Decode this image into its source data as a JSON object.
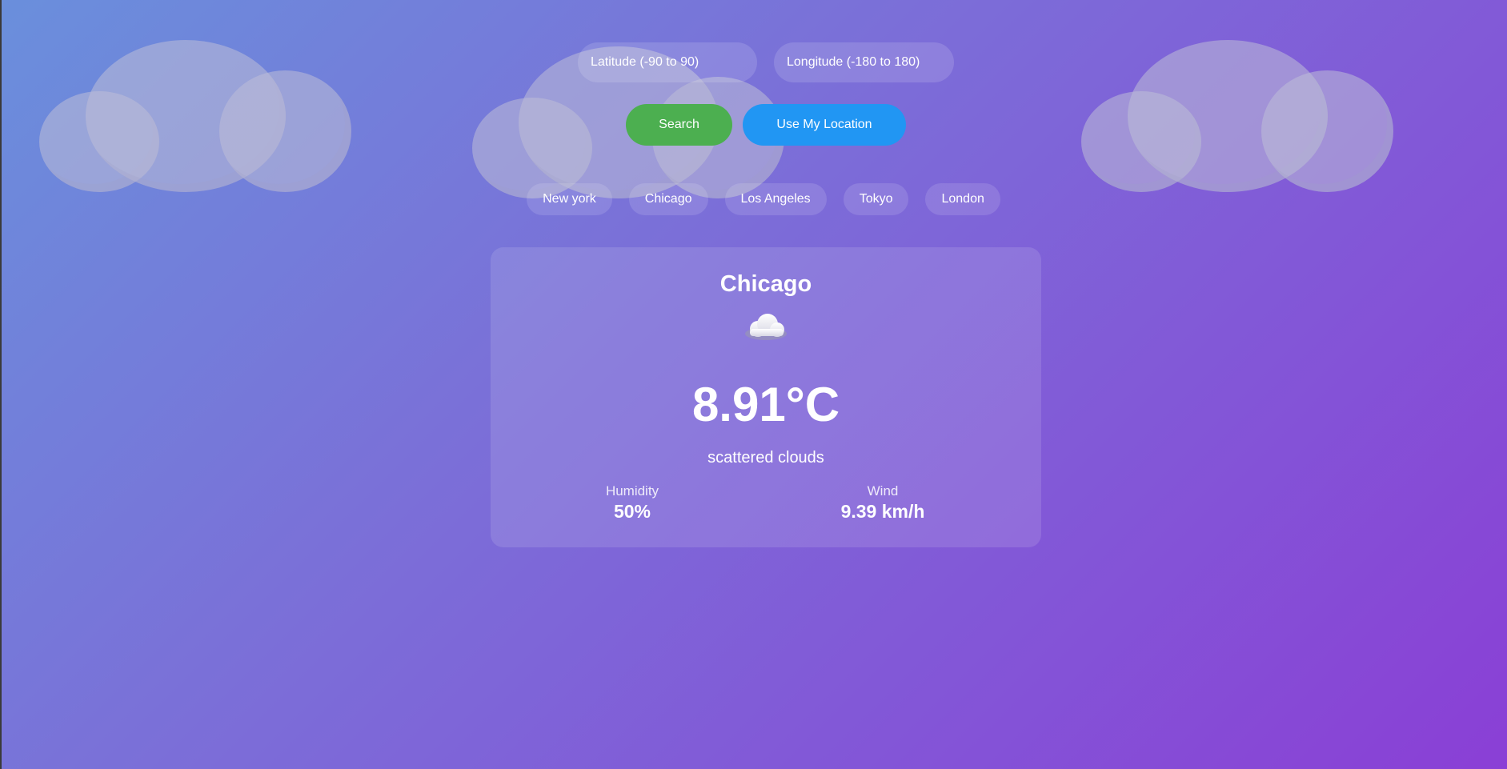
{
  "search": {
    "latitude_placeholder": "Latitude (-90 to 90)",
    "longitude_placeholder": "Longitude (-180 to 180)",
    "search_label": "Search",
    "location_label": "Use My Location"
  },
  "cities": [
    {
      "label": "New york"
    },
    {
      "label": "Chicago"
    },
    {
      "label": "Los Angeles"
    },
    {
      "label": "Tokyo"
    },
    {
      "label": "London"
    }
  ],
  "weather": {
    "city": "Chicago",
    "icon": "cloud-icon",
    "temperature": "8.91°C",
    "description": "scattered clouds",
    "humidity_label": "Humidity",
    "humidity_value": "50%",
    "wind_label": "Wind",
    "wind_value": "9.39 km/h"
  },
  "colors": {
    "search_button": "#4caf50",
    "location_button": "#2196f3",
    "background_start": "#6a8fdc",
    "background_end": "#8a3fd6"
  }
}
